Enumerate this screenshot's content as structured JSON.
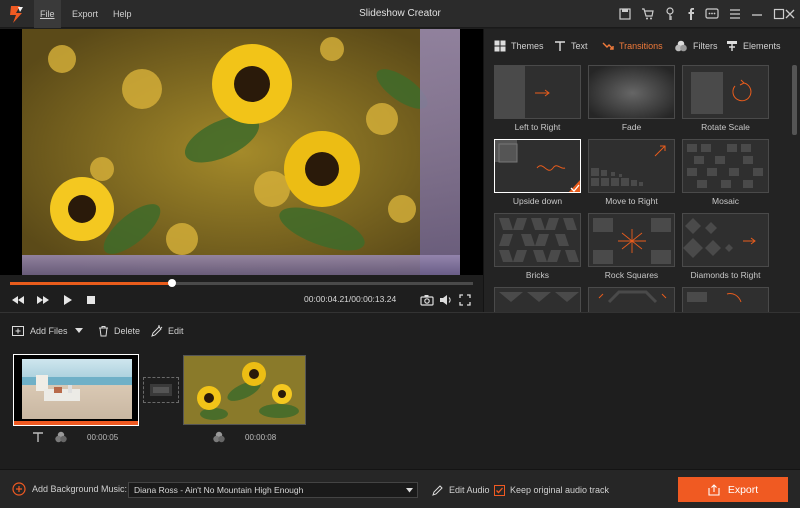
{
  "window": {
    "title": "Slideshow Creator"
  },
  "menu": {
    "file": "File",
    "export": "Export",
    "help": "Help"
  },
  "titlebar_icons": [
    "save-icon",
    "cart-icon",
    "key-icon",
    "facebook-icon",
    "chat-icon",
    "menu-icon",
    "minimize-icon",
    "maximize-icon",
    "close-icon"
  ],
  "player": {
    "time_current": "00:00:04.21",
    "time_total": "00:00:13.24",
    "progress": 0.35
  },
  "panel_tabs": [
    {
      "label": "Themes",
      "icon": "themes-icon"
    },
    {
      "label": "Text",
      "icon": "text-icon"
    },
    {
      "label": "Transitions",
      "icon": "transitions-icon",
      "active": true
    },
    {
      "label": "Filters",
      "icon": "filters-icon"
    },
    {
      "label": "Elements",
      "icon": "elements-icon"
    }
  ],
  "transitions": [
    {
      "label": "Left to Right"
    },
    {
      "label": "Fade"
    },
    {
      "label": "Rotate Scale"
    },
    {
      "label": "Upside down",
      "selected": true
    },
    {
      "label": "Move to Right"
    },
    {
      "label": "Mosaic"
    },
    {
      "label": "Bricks"
    },
    {
      "label": "Rock Squares"
    },
    {
      "label": "Diamonds to Right"
    }
  ],
  "toolbar": {
    "add_files": "Add Files",
    "delete": "Delete",
    "edit": "Edit"
  },
  "clips": [
    {
      "duration": "00:00:05",
      "selected": true
    },
    {
      "duration": "00:00:08"
    }
  ],
  "bottom": {
    "add_music_label": "Add Background Music:",
    "music_value": "Diana Ross - Ain't No Mountain High Enough",
    "edit_audio": "Edit Audio",
    "keep_audio": "Keep original audio track",
    "keep_audio_checked": true,
    "export": "Export"
  },
  "colors": {
    "accent": "#f05a22",
    "panel_bg": "#232323",
    "background": "#1e1e1e"
  }
}
